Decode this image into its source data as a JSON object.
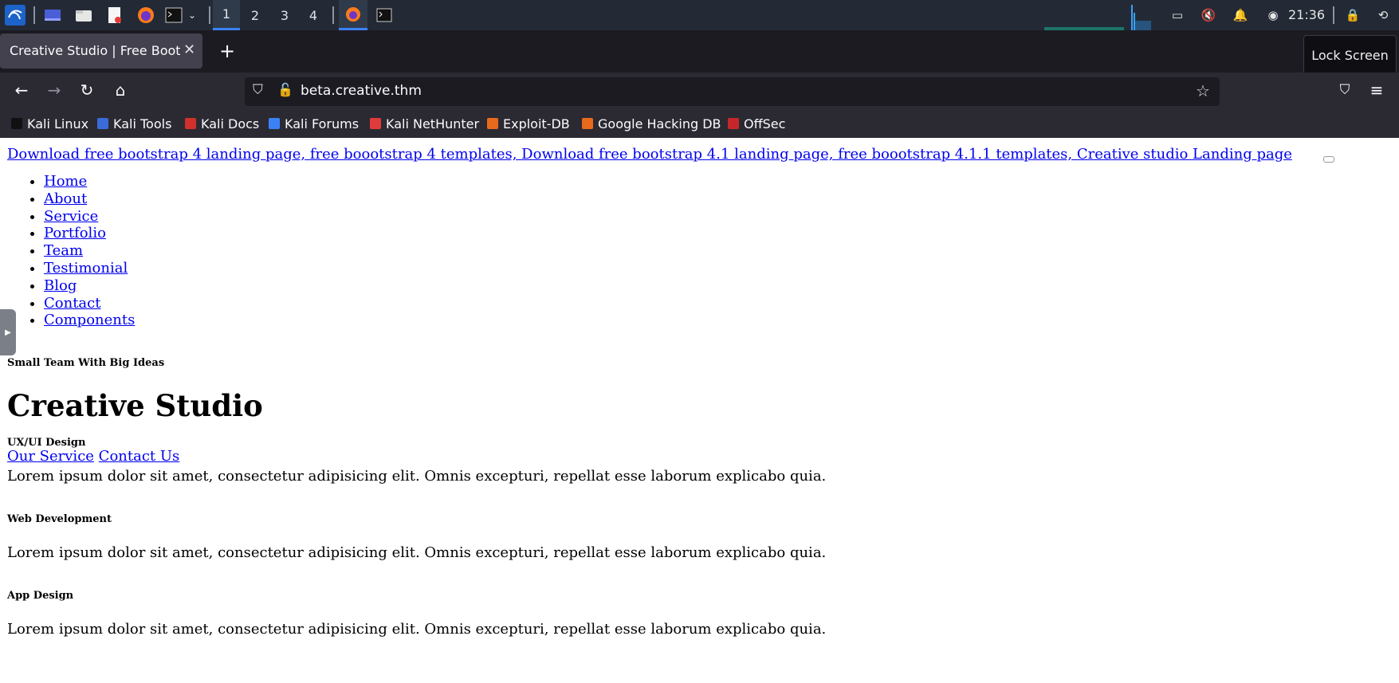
{
  "taskbar": {
    "workspaces": [
      "1",
      "2",
      "3",
      "4"
    ],
    "active_workspace": "1",
    "clock": "21:36"
  },
  "browser": {
    "tab_title": "Creative Studio | Free Bootstr",
    "tooltip": "Lock Screen",
    "url": "beta.creative.thm",
    "bookmarks": [
      {
        "label": "Kali Linux",
        "color": "#111111"
      },
      {
        "label": "Kali Tools",
        "color": "#3b6bd6"
      },
      {
        "label": "Kali Docs",
        "color": "#d0312d"
      },
      {
        "label": "Kali Forums",
        "color": "#3b82f6"
      },
      {
        "label": "Kali NetHunter",
        "color": "#e03b3b"
      },
      {
        "label": "Exploit-DB",
        "color": "#e86a1c"
      },
      {
        "label": "Google Hacking DB",
        "color": "#e86a1c"
      },
      {
        "label": "OffSec",
        "color": "#c7262b"
      }
    ]
  },
  "page": {
    "top_link": "Download free bootstrap 4 landing page, free boootstrap 4 templates, Download free bootstrap 4.1 landing page, free boootstrap 4.1.1 templates, Creative studio Landing page",
    "menu": [
      "Home",
      "About",
      "Service",
      "Portfolio",
      "Team",
      "Testimonial",
      "Blog",
      "Contact",
      "Components"
    ],
    "tagline": "Small Team With Big Ideas",
    "hero_title": "Creative Studio",
    "cta_service": "Our Service",
    "cta_contact": "Contact Us",
    "services": [
      {
        "heading": "UX/UI Design",
        "text": "Lorem ipsum dolor sit amet, consectetur adipisicing elit. Omnis excepturi, repellat esse laborum explicabo quia."
      },
      {
        "heading": "Web Development",
        "text": "Lorem ipsum dolor sit amet, consectetur adipisicing elit. Omnis excepturi, repellat esse laborum explicabo quia."
      },
      {
        "heading": "App Design",
        "text": "Lorem ipsum dolor sit amet, consectetur adipisicing elit. Omnis excepturi, repellat esse laborum explicabo quia."
      }
    ]
  }
}
